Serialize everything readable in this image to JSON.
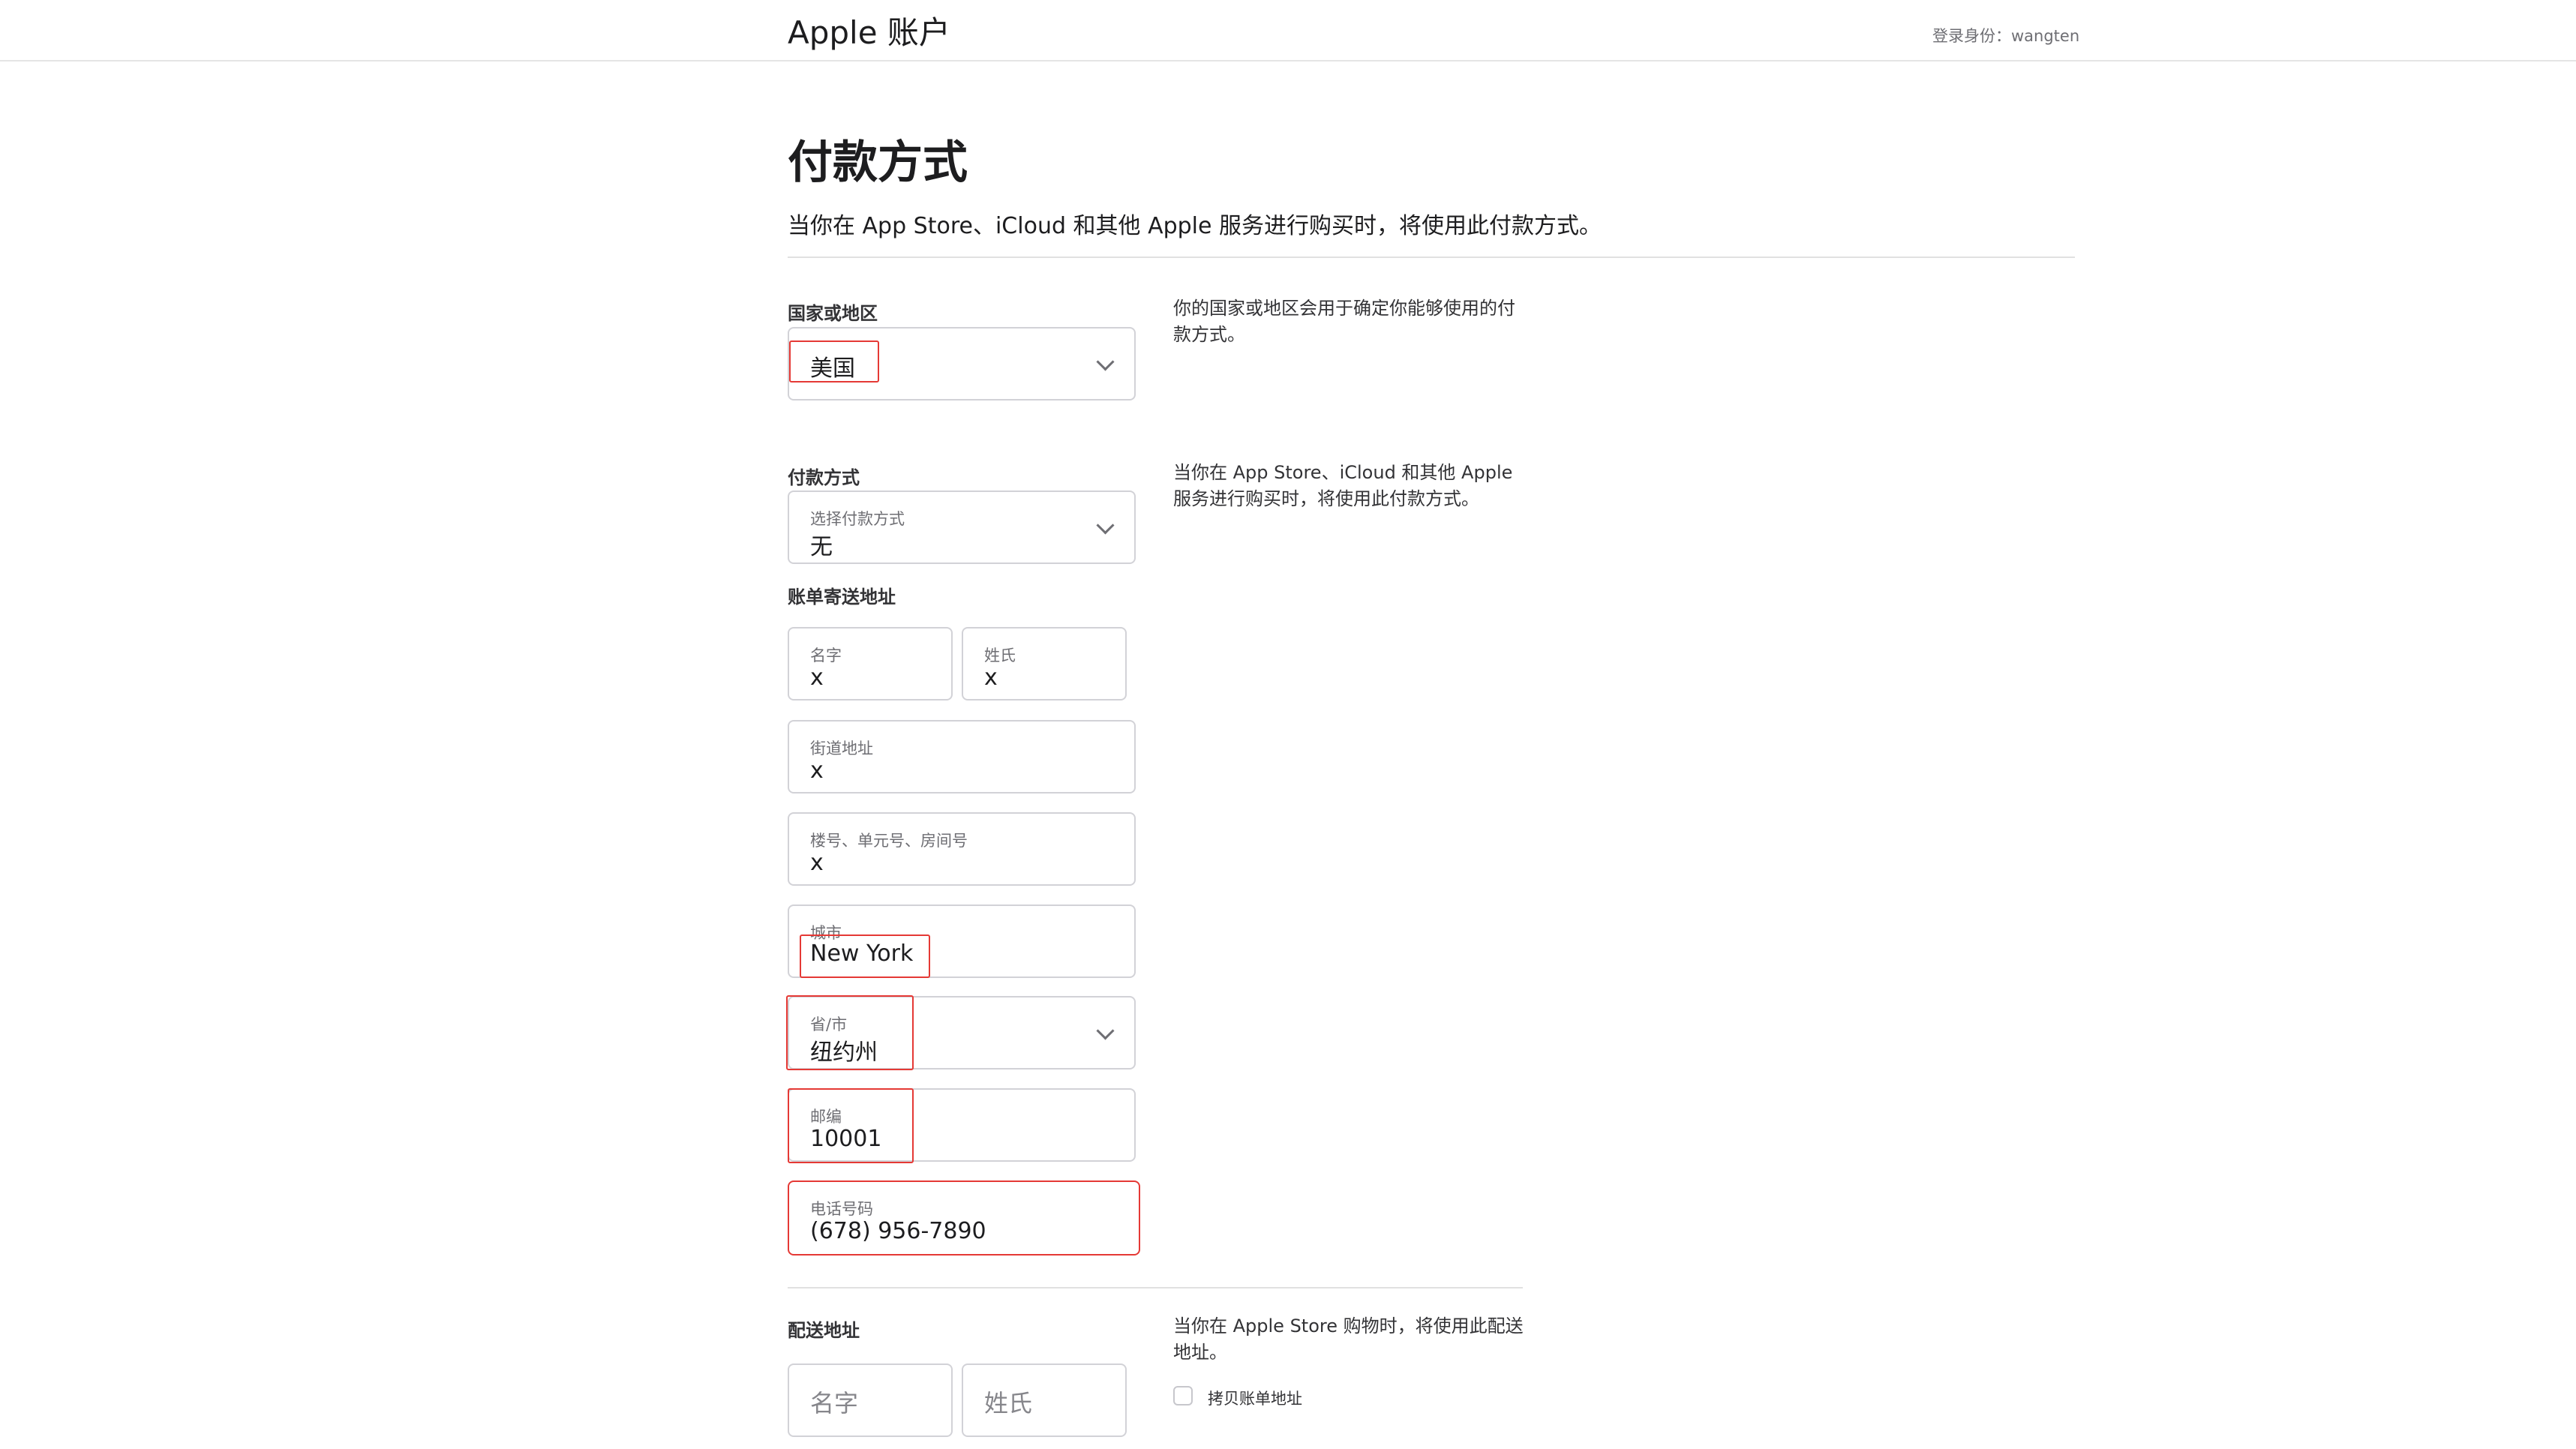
{
  "header": {
    "brand": "Apple 账户",
    "login_prefix": "登录身份：",
    "login_user": "wangten"
  },
  "page": {
    "title": "付款方式",
    "intro": "当你在 App Store、iCloud 和其他 Apple 服务进行购买时，将使用此付款方式。"
  },
  "country": {
    "label": "国家或地区",
    "value": "美国",
    "description": "你的国家或地区会用于确定你能够使用的付款方式。"
  },
  "payment": {
    "label": "付款方式",
    "select_label": "选择付款方式",
    "select_value": "无",
    "description": "当你在 App Store、iCloud 和其他 Apple 服务进行购买时，将使用此付款方式。"
  },
  "billing": {
    "label": "账单寄送地址",
    "first_name": {
      "label": "名字",
      "value": "x"
    },
    "last_name": {
      "label": "姓氏",
      "value": "x"
    },
    "street": {
      "label": "街道地址",
      "value": "x"
    },
    "apartment": {
      "label": "楼号、单元号、房间号",
      "value": "x"
    },
    "city": {
      "label": "城市",
      "value": "New York"
    },
    "state": {
      "label": "省/市",
      "value": "纽约州"
    },
    "zip": {
      "label": "邮编",
      "value": "10001"
    },
    "phone": {
      "label": "电话号码",
      "value": "(678) 956-7890"
    }
  },
  "shipping": {
    "label": "配送地址",
    "description": "当你在 Apple Store 购物时，将使用此配送地址。",
    "first_name_placeholder": "名字",
    "last_name_placeholder": "姓氏",
    "copy_billing_label": "拷贝账单地址"
  },
  "colors": {
    "highlight": "#e53935",
    "border": "#d2d2d7",
    "text": "#1d1d1f"
  }
}
